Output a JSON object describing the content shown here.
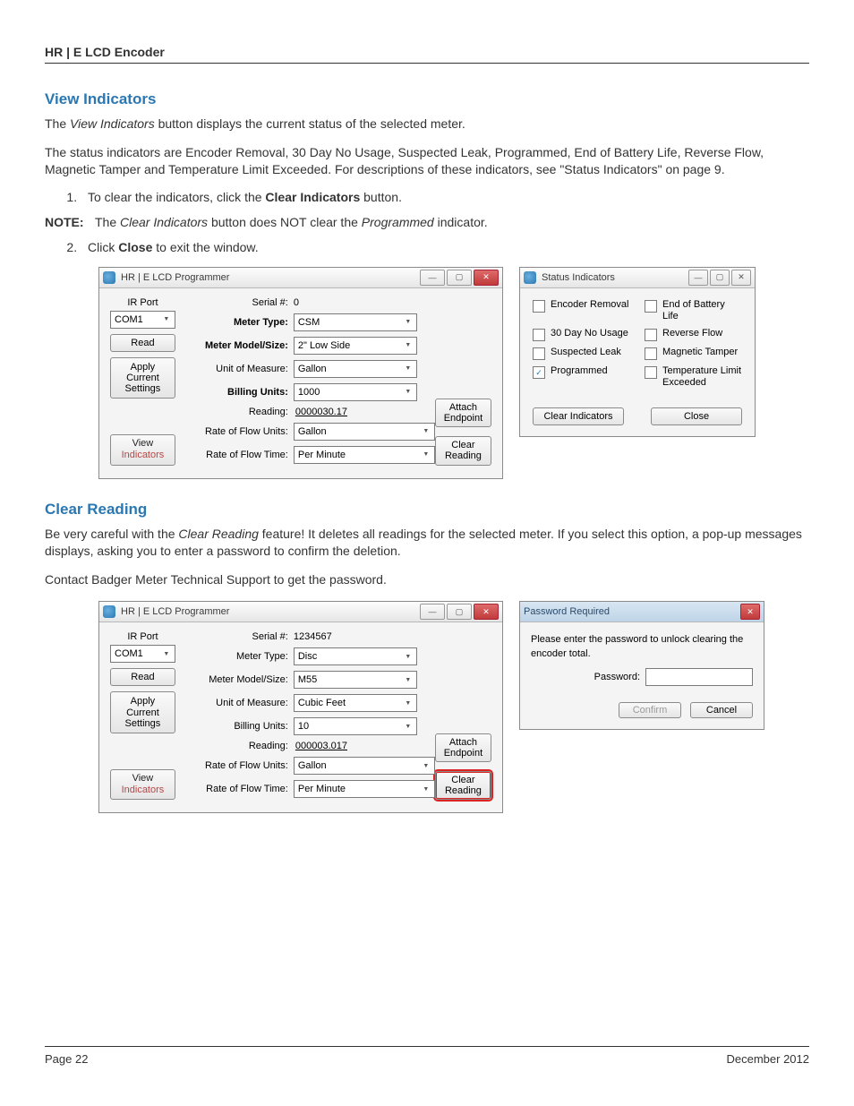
{
  "header": {
    "title": "HR | E LCD Encoder"
  },
  "sections": {
    "viewIndicators": {
      "heading": "View Indicators",
      "p1a": "The ",
      "p1b": "View Indicators",
      "p1c": " button displays the current status of the selected meter.",
      "p2": "The status indicators are Encoder Removal, 30 Day No Usage, Suspected Leak, Programmed, End of Battery Life, Reverse Flow, Magnetic Tamper and Temperature Limit Exceeded. For descriptions of these indicators, see \"Status Indicators\" on page 9.",
      "step1a": "To clear the indicators, click the ",
      "step1b": "Clear Indicators",
      "step1c": " button.",
      "note_label": "NOTE:",
      "note_a": "The ",
      "note_b": "Clear Indicators",
      "note_c": " button does NOT clear the ",
      "note_d": "Programmed",
      "note_e": " indicator.",
      "step2a": "Click ",
      "step2b": "Close",
      "step2c": " to exit the window."
    },
    "clearReading": {
      "heading": "Clear Reading",
      "p1a": "Be very careful with the ",
      "p1b": "Clear Reading",
      "p1c": " feature! It deletes all readings for the selected meter. If you select this option, a pop-up messages displays, asking you to enter a password to confirm the deletion.",
      "p2": "Contact Badger Meter Technical Support to get the password."
    }
  },
  "programmer1": {
    "title": "HR | E LCD Programmer",
    "irport_label": "IR Port",
    "irport_value": "COM1",
    "read_btn": "Read",
    "apply_btn_l1": "Apply",
    "apply_btn_l2": "Current",
    "apply_btn_l3": "Settings",
    "view_l1": "View",
    "view_l2": "Indicators",
    "labels": {
      "serial": "Serial #:",
      "mtype": "Meter Type:",
      "mmodel": "Meter Model/Size:",
      "uom": "Unit of Measure:",
      "bunits": "Billing Units:",
      "reading": "Reading:",
      "rfu": "Rate of Flow Units:",
      "rft": "Rate of Flow Time:"
    },
    "values": {
      "serial": "0",
      "mtype": "CSM",
      "mmodel": "2\" Low Side",
      "uom": "Gallon",
      "bunits": "1000",
      "reading": "0000030.17",
      "rfu": "Gallon",
      "rft": "Per Minute"
    },
    "attach_btn_l1": "Attach",
    "attach_btn_l2": "Endpoint",
    "clear_btn_l1": "Clear",
    "clear_btn_l2": "Reading"
  },
  "status": {
    "title": "Status Indicators",
    "items": [
      {
        "label": "Encoder Removal",
        "checked": false
      },
      {
        "label": "End of Battery Life",
        "checked": false
      },
      {
        "label": "30 Day No Usage",
        "checked": false
      },
      {
        "label": "Reverse Flow",
        "checked": false
      },
      {
        "label": "Suspected Leak",
        "checked": false
      },
      {
        "label": "Magnetic Tamper",
        "checked": false
      },
      {
        "label": "Programmed",
        "checked": true
      },
      {
        "label": "Temperature Limit Exceeded",
        "checked": false
      }
    ],
    "clear_btn": "Clear Indicators",
    "close_btn": "Close"
  },
  "programmer2": {
    "title": "HR | E LCD Programmer",
    "values": {
      "serial": "1234567",
      "mtype": "Disc",
      "mmodel": "M55",
      "uom": "Cubic Feet",
      "bunits": "10",
      "reading": "000003.017",
      "rfu": "Gallon",
      "rft": "Per Minute"
    }
  },
  "password": {
    "title": "Password Required",
    "msg": "Please enter the password to unlock clearing the encoder total.",
    "label": "Password:",
    "confirm": "Confirm",
    "cancel": "Cancel"
  },
  "footer": {
    "page": "Page 22",
    "date": "December 2012"
  }
}
